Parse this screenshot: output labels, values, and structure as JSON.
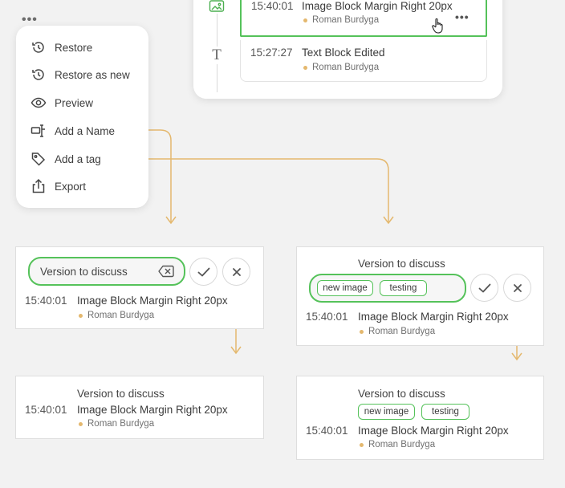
{
  "colors": {
    "accent_green": "#55c25a",
    "arrow": "#e4b86e",
    "author_dot": "#e4b86e"
  },
  "top_menu_icon": "more-dots-icon",
  "context_menu": {
    "items": [
      {
        "label": "Restore",
        "icon": "restore-icon"
      },
      {
        "label": "Restore as new",
        "icon": "restore-as-new-icon"
      },
      {
        "label": "Preview",
        "icon": "eye-icon"
      },
      {
        "label": "Add a Name",
        "icon": "rename-icon"
      },
      {
        "label": "Add a tag",
        "icon": "tag-icon"
      },
      {
        "label": "Export",
        "icon": "export-icon"
      }
    ]
  },
  "history": {
    "rows": [
      {
        "time": "15:40:01",
        "title": "Image Block Margin Right 20px",
        "author": "Roman Burdyga",
        "icon": "image-icon",
        "selected": true
      },
      {
        "time": "15:27:27",
        "title": "Text Block Edited",
        "author": "Roman Burdyga",
        "icon": "text-icon",
        "selected": false
      }
    ]
  },
  "name_edit": {
    "input_value": "Version to discuss",
    "time": "15:40:01",
    "title": "Image Block Margin Right 20px",
    "author": "Roman Burdyga"
  },
  "name_result": {
    "name": "Version to discuss",
    "time": "15:40:01",
    "title": "Image Block Margin Right 20px",
    "author": "Roman Burdyga"
  },
  "tag_edit": {
    "name": "Version to discuss",
    "tags": [
      "new image",
      "testing"
    ],
    "time": "15:40:01",
    "title": "Image Block Margin Right 20px",
    "author": "Roman Burdyga"
  },
  "tag_result": {
    "name": "Version to discuss",
    "tags": [
      "new image",
      "testing"
    ],
    "time": "15:40:01",
    "title": "Image Block Margin Right 20px",
    "author": "Roman Burdyga"
  }
}
